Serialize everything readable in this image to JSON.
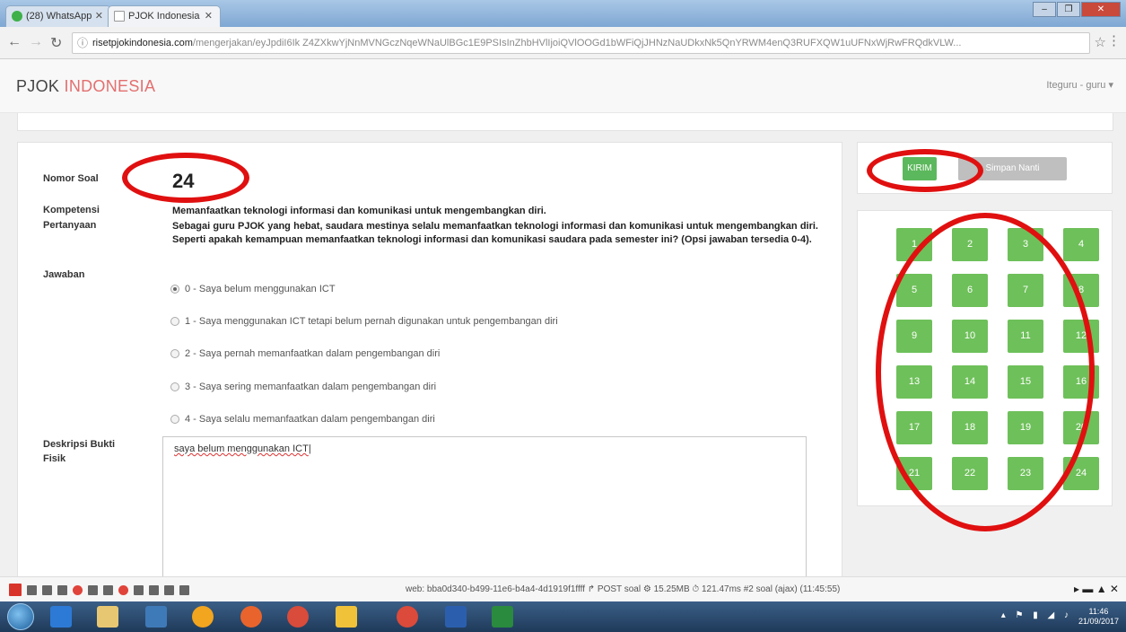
{
  "browser": {
    "tabs": [
      {
        "title": "(28) WhatsApp",
        "active": false
      },
      {
        "title": "PJOK Indonesia",
        "active": true
      }
    ],
    "url_host": "risetpjokindonesia.com",
    "url_path": "/mengerjakan/eyJpdiI6Ik Z4ZXkwYjNnMVNGczNqeWNaUlBGc1E9PSIsInZhbHVlIjoiQVlOOGd1bWFiQjJHNzNaUDkxNk5QnYRWM4enQ3RUFXQW1uUFNxWjRwFRQdkVLW..."
  },
  "app": {
    "brand_main": "PJOK",
    "brand_accent": "INDONESIA",
    "user_menu": "Iteguru - guru"
  },
  "question": {
    "nomor_label": "Nomor Soal",
    "nomor_value": "24",
    "kompetensi_label": "Kompetensi",
    "kompetensi_value": "Memanfaatkan teknologi informasi dan komunikasi untuk mengembangkan diri.",
    "pertanyaan_label": "Pertanyaan",
    "pertanyaan_value": "Sebagai guru PJOK yang hebat, saudara mestinya selalu memanfaatkan teknologi informasi dan komunikasi untuk mengembangkan diri. Seperti apakah kemampuan memanfaatkan teknologi informasi dan komunikasi saudara pada semester ini? (Opsi jawaban tersedia 0-4).",
    "jawaban_label": "Jawaban",
    "options": [
      {
        "text": "0 - Saya belum menggunakan ICT",
        "checked": true
      },
      {
        "text": "1 - Saya menggunakan ICT tetapi belum pernah digunakan untuk pengembangan diri",
        "checked": false
      },
      {
        "text": "2 - Saya pernah memanfaatkan dalam pengembangan diri",
        "checked": false
      },
      {
        "text": "3 - Saya sering memanfaatkan dalam pengembangan diri",
        "checked": false
      },
      {
        "text": "4 - Saya selalu memanfaatkan dalam pengembangan diri",
        "checked": false
      }
    ],
    "deskripsi_label_1": "Deskripsi Bukti",
    "deskripsi_label_2": "Fisik",
    "deskripsi_value": "saya belum menggunakan ICT"
  },
  "actions": {
    "kirim": "KIRIM",
    "simpan": "Simpan Nanti"
  },
  "question_nav": [
    "1",
    "2",
    "3",
    "4",
    "5",
    "6",
    "7",
    "8",
    "9",
    "10",
    "11",
    "12",
    "13",
    "14",
    "15",
    "16",
    "17",
    "18",
    "19",
    "20",
    "21",
    "22",
    "23",
    "24"
  ],
  "debugbar": {
    "info": "web: bba0d340-b499-11e6-b4a4-4d1919f1ffff  ↱ POST soal  ⚙ 15.25MB  ⏱ 121.47ms  #2 soal (ajax) (11:45:55)"
  },
  "taskbar": {
    "time": "11:46",
    "date": "21/09/2017"
  },
  "colors": {
    "accent_green": "#5cb85c",
    "brand_accent": "#e36f6f",
    "annotation_red": "#e01010"
  }
}
